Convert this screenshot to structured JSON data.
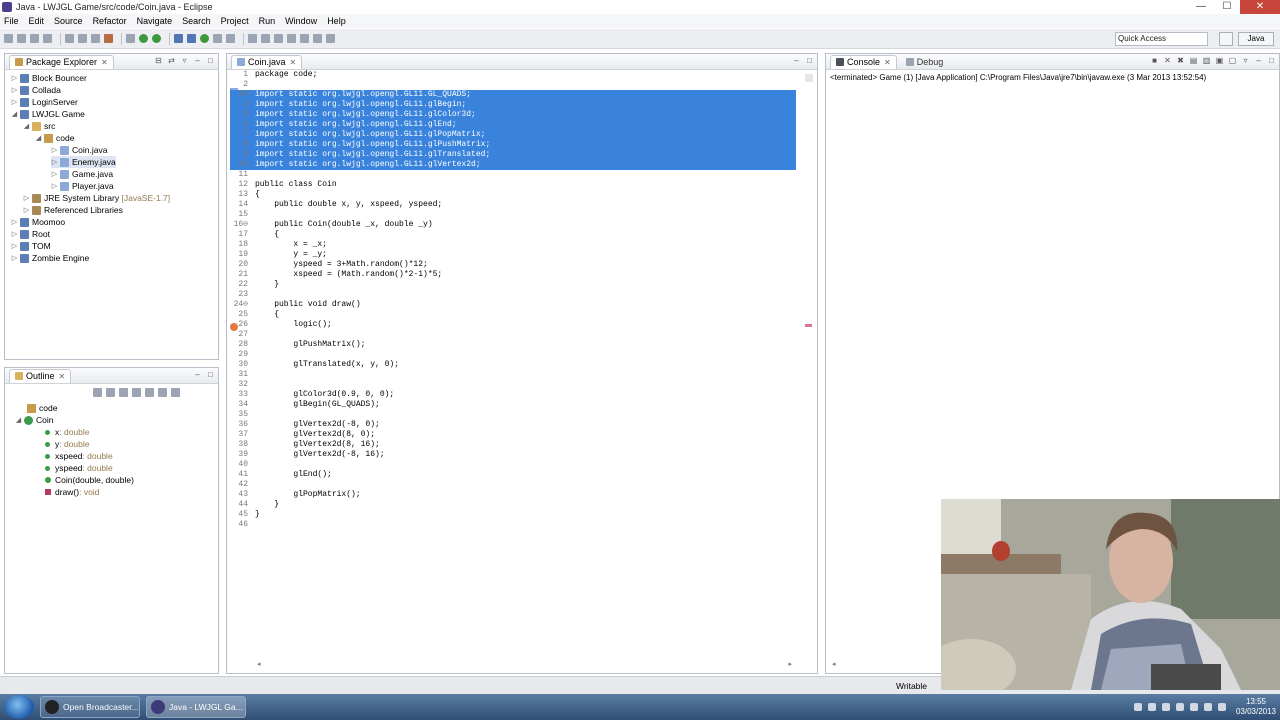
{
  "window": {
    "title": "Java - LWJGL Game/src/code/Coin.java - Eclipse",
    "min": "—",
    "max": "☐",
    "close": "✕"
  },
  "menu": [
    "File",
    "Edit",
    "Source",
    "Refactor",
    "Navigate",
    "Search",
    "Project",
    "Run",
    "Window",
    "Help"
  ],
  "toolbar": {
    "quick_access": "Quick Access",
    "perspective": "Java"
  },
  "package_explorer": {
    "tab": "Package Explorer",
    "items": [
      {
        "label": "Block Bouncer"
      },
      {
        "label": "Collada"
      },
      {
        "label": "LoginServer"
      },
      {
        "label": "LWJGL Game"
      },
      {
        "label": "src"
      },
      {
        "label": "code"
      },
      {
        "label": "Coin.java"
      },
      {
        "label": "Enemy.java"
      },
      {
        "label": "Game.java"
      },
      {
        "label": "Player.java"
      },
      {
        "label": "JRE System Library",
        "decor": "[JavaSE-1.7]"
      },
      {
        "label": "Referenced Libraries"
      },
      {
        "label": "Moomoo"
      },
      {
        "label": "Root"
      },
      {
        "label": "TOM"
      },
      {
        "label": "Zombie Engine"
      }
    ]
  },
  "outline": {
    "tab": "Outline",
    "items": [
      {
        "label": "code",
        "type": ""
      },
      {
        "label": "Coin",
        "type": ""
      },
      {
        "label": "x",
        "type": " : double"
      },
      {
        "label": "y",
        "type": " : double"
      },
      {
        "label": "xspeed",
        "type": " : double"
      },
      {
        "label": "yspeed",
        "type": " : double"
      },
      {
        "label": "Coin(double, double)",
        "type": ""
      },
      {
        "label": "draw()",
        "type": " : void"
      }
    ]
  },
  "editor": {
    "tab": "Coin.java",
    "lines": [
      {
        "n": "1",
        "t": "package code;"
      },
      {
        "n": "2",
        "t": ""
      },
      {
        "n": "3⊖",
        "t": "import static org.lwjgl.opengl.GL11.GL_QUADS;"
      },
      {
        "n": "4",
        "t": "import static org.lwjgl.opengl.GL11.glBegin;"
      },
      {
        "n": "5",
        "t": "import static org.lwjgl.opengl.GL11.glColor3d;"
      },
      {
        "n": "6",
        "t": "import static org.lwjgl.opengl.GL11.glEnd;"
      },
      {
        "n": "7",
        "t": "import static org.lwjgl.opengl.GL11.glPopMatrix;"
      },
      {
        "n": "8",
        "t": "import static org.lwjgl.opengl.GL11.glPushMatrix;"
      },
      {
        "n": "9",
        "t": "import static org.lwjgl.opengl.GL11.glTranslated;"
      },
      {
        "n": "10",
        "t": "import static org.lwjgl.opengl.GL11.glVertex2d;"
      },
      {
        "n": "11",
        "t": ""
      },
      {
        "n": "12",
        "t": "public class Coin"
      },
      {
        "n": "13",
        "t": "{"
      },
      {
        "n": "14",
        "t": "    public double x, y, xspeed, yspeed;"
      },
      {
        "n": "15",
        "t": ""
      },
      {
        "n": "16⊖",
        "t": "    public Coin(double _x, double _y)"
      },
      {
        "n": "17",
        "t": "    {"
      },
      {
        "n": "18",
        "t": "        x = _x;"
      },
      {
        "n": "19",
        "t": "        y = _y;"
      },
      {
        "n": "20",
        "t": "        yspeed = 3+Math.random()*12;"
      },
      {
        "n": "21",
        "t": "        xspeed = (Math.random()*2-1)*5;"
      },
      {
        "n": "22",
        "t": "    }"
      },
      {
        "n": "23",
        "t": ""
      },
      {
        "n": "24⊖",
        "t": "    public void draw()"
      },
      {
        "n": "25",
        "t": "    {"
      },
      {
        "n": "26",
        "t": "        logic();"
      },
      {
        "n": "27",
        "t": ""
      },
      {
        "n": "28",
        "t": "        glPushMatrix();"
      },
      {
        "n": "29",
        "t": ""
      },
      {
        "n": "30",
        "t": "        glTranslated(x, y, 0);"
      },
      {
        "n": "31",
        "t": ""
      },
      {
        "n": "32",
        "t": ""
      },
      {
        "n": "33",
        "t": "        glColor3d(0.9, 0, 0);"
      },
      {
        "n": "34",
        "t": "        glBegin(GL_QUADS);"
      },
      {
        "n": "35",
        "t": ""
      },
      {
        "n": "36",
        "t": "        glVertex2d(-8, 0);"
      },
      {
        "n": "37",
        "t": "        glVertex2d(8, 0);"
      },
      {
        "n": "38",
        "t": "        glVertex2d(8, 16);"
      },
      {
        "n": "39",
        "t": "        glVertex2d(-8, 16);"
      },
      {
        "n": "40",
        "t": ""
      },
      {
        "n": "41",
        "t": "        glEnd();"
      },
      {
        "n": "42",
        "t": ""
      },
      {
        "n": "43",
        "t": "        glPopMatrix();"
      },
      {
        "n": "44",
        "t": "    }"
      },
      {
        "n": "45",
        "t": "}"
      },
      {
        "n": "46",
        "t": ""
      }
    ]
  },
  "console": {
    "tab": "Console",
    "tab2": "Debug",
    "output": "<terminated> Game (1) [Java Application] C:\\Program Files\\Java\\jre7\\bin\\javaw.exe (3 Mar 2013 13:52:54)"
  },
  "status": {
    "writable": "Writable"
  },
  "taskbar": {
    "items": [
      "Open Broadcaster...",
      "Java - LWJGL Ga..."
    ],
    "time": "13:55",
    "date": "03/03/2013"
  },
  "colors": {
    "selection": "#3a83dc",
    "keyword": "#7f0055",
    "static_ref": "#0000c0"
  }
}
